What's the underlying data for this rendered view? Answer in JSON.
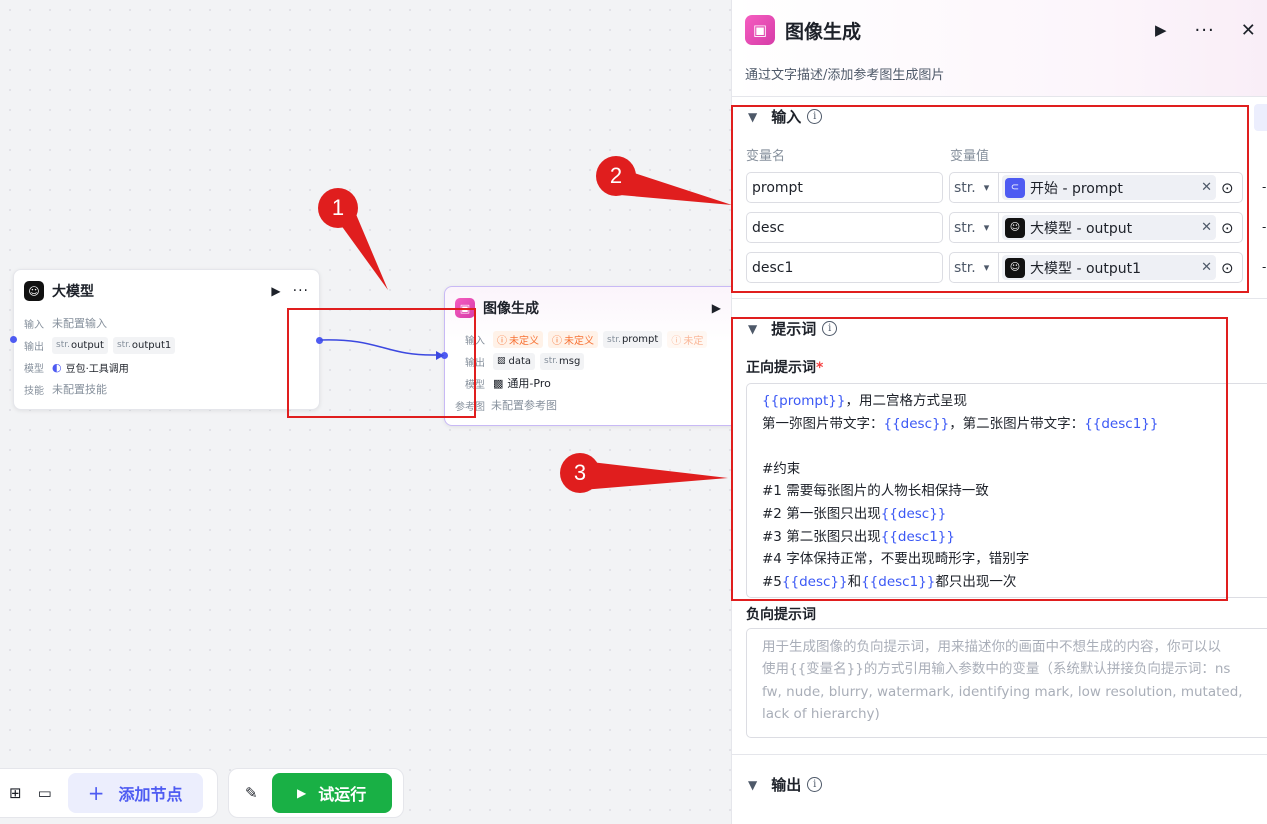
{
  "canvas": {
    "llm_node": {
      "title": "大模型",
      "rows": [
        {
          "key": "输入",
          "value": "未配置输入"
        },
        {
          "key": "输出",
          "tags": [
            {
              "pre": "str.",
              "label": "output"
            },
            {
              "pre": "str.",
              "label": "output1"
            }
          ]
        },
        {
          "key": "模型",
          "value": "豆包·工具调用"
        },
        {
          "key": "技能",
          "value": "未配置技能"
        }
      ]
    },
    "image_node": {
      "title": "图像生成",
      "input_key": "输入",
      "input_tags": [
        "未定义",
        "未定义",
        "prompt",
        "未定"
      ],
      "output_key": "输出",
      "output_tags": [
        "data",
        "msg"
      ],
      "model_key": "模型",
      "model_value": "通用-Pro",
      "ref_key": "参考图",
      "ref_value": "未配置参考图"
    },
    "callouts": [
      "1",
      "2",
      "3"
    ]
  },
  "toolbar": {
    "add_node_label": "添加节点",
    "run_label": "试运行"
  },
  "panel": {
    "title": "图像生成",
    "description": "通过文字描述/添加参考图生成图片",
    "input_section": {
      "title": "输入",
      "col_name": "变量名",
      "col_value": "变量值",
      "rows": [
        {
          "name": "prompt",
          "type": "str.",
          "source": "开始 - prompt"
        },
        {
          "name": "desc",
          "type": "str.",
          "source": "大模型 - output"
        },
        {
          "name": "desc1",
          "type": "str.",
          "source": "大模型 - output1"
        }
      ]
    },
    "prompt_section": {
      "title": "提示词",
      "positive_label": "正向提示词",
      "required_mark": "*",
      "positive_lines": [
        [
          {
            "v": "{{prompt}}"
          },
          {
            "t": "，用二宫格方式呈现"
          }
        ],
        [
          {
            "t": "第一弥图片带文字："
          },
          {
            "v": "{{desc}}"
          },
          {
            "t": "，第二张图片带文字："
          },
          {
            "v": "{{desc1}}"
          }
        ],
        [
          {
            "t": ""
          }
        ],
        [
          {
            "t": "#约束"
          }
        ],
        [
          {
            "t": "#1 需要每张图片的人物长相保持一致"
          }
        ],
        [
          {
            "t": "#2 第一张图只出现"
          },
          {
            "v": "{{desc}}"
          }
        ],
        [
          {
            "t": "#3 第二张图只出现"
          },
          {
            "v": "{{desc1}}"
          }
        ],
        [
          {
            "t": "#4 字体保持正常，不要出现畸形字，错别字"
          }
        ],
        [
          {
            "t": "#5"
          },
          {
            "v": "{{desc}}"
          },
          {
            "t": "和"
          },
          {
            "v": "{{desc1}}"
          },
          {
            "t": "都只出现一次"
          }
        ]
      ],
      "negative_label": "负向提示词",
      "negative_placeholder_lines": [
        "用于生成图像的负向提示词，用来描述你的画面中不想生成的内容，你可以以",
        "使用{{变量名}}的方式引用输入参数中的变量（系统默认拼接负向提示词：ns",
        "fw, nude, blurry, watermark, identifying mark, low resolution, mutated,",
        "lack of hierarchy)"
      ]
    },
    "output_section": {
      "title": "输出"
    }
  },
  "colors": {
    "accent": "#4e5bf2",
    "run_green": "#19b045",
    "annotation_red": "#e01e1e",
    "variable_blue": "#3b58f5"
  }
}
